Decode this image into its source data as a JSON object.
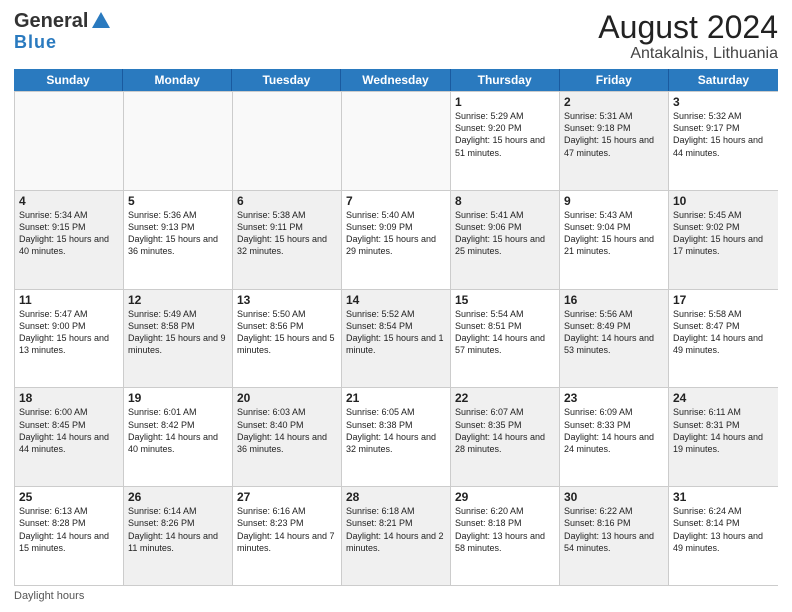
{
  "header": {
    "logo_general": "General",
    "logo_blue": "Blue",
    "month_year": "August 2024",
    "location": "Antakalnis, Lithuania"
  },
  "days_of_week": [
    "Sunday",
    "Monday",
    "Tuesday",
    "Wednesday",
    "Thursday",
    "Friday",
    "Saturday"
  ],
  "footer": {
    "daylight_hours": "Daylight hours"
  },
  "weeks": [
    {
      "cells": [
        {
          "day": "",
          "empty": true
        },
        {
          "day": "",
          "empty": true
        },
        {
          "day": "",
          "empty": true
        },
        {
          "day": "",
          "empty": true
        },
        {
          "day": "1",
          "sunrise": "Sunrise: 5:29 AM",
          "sunset": "Sunset: 9:20 PM",
          "daylight": "Daylight: 15 hours and 51 minutes.",
          "shaded": false
        },
        {
          "day": "2",
          "sunrise": "Sunrise: 5:31 AM",
          "sunset": "Sunset: 9:18 PM",
          "daylight": "Daylight: 15 hours and 47 minutes.",
          "shaded": true
        },
        {
          "day": "3",
          "sunrise": "Sunrise: 5:32 AM",
          "sunset": "Sunset: 9:17 PM",
          "daylight": "Daylight: 15 hours and 44 minutes.",
          "shaded": false
        }
      ]
    },
    {
      "cells": [
        {
          "day": "4",
          "sunrise": "Sunrise: 5:34 AM",
          "sunset": "Sunset: 9:15 PM",
          "daylight": "Daylight: 15 hours and 40 minutes.",
          "shaded": true
        },
        {
          "day": "5",
          "sunrise": "Sunrise: 5:36 AM",
          "sunset": "Sunset: 9:13 PM",
          "daylight": "Daylight: 15 hours and 36 minutes.",
          "shaded": false
        },
        {
          "day": "6",
          "sunrise": "Sunrise: 5:38 AM",
          "sunset": "Sunset: 9:11 PM",
          "daylight": "Daylight: 15 hours and 32 minutes.",
          "shaded": true
        },
        {
          "day": "7",
          "sunrise": "Sunrise: 5:40 AM",
          "sunset": "Sunset: 9:09 PM",
          "daylight": "Daylight: 15 hours and 29 minutes.",
          "shaded": false
        },
        {
          "day": "8",
          "sunrise": "Sunrise: 5:41 AM",
          "sunset": "Sunset: 9:06 PM",
          "daylight": "Daylight: 15 hours and 25 minutes.",
          "shaded": true
        },
        {
          "day": "9",
          "sunrise": "Sunrise: 5:43 AM",
          "sunset": "Sunset: 9:04 PM",
          "daylight": "Daylight: 15 hours and 21 minutes.",
          "shaded": false
        },
        {
          "day": "10",
          "sunrise": "Sunrise: 5:45 AM",
          "sunset": "Sunset: 9:02 PM",
          "daylight": "Daylight: 15 hours and 17 minutes.",
          "shaded": true
        }
      ]
    },
    {
      "cells": [
        {
          "day": "11",
          "sunrise": "Sunrise: 5:47 AM",
          "sunset": "Sunset: 9:00 PM",
          "daylight": "Daylight: 15 hours and 13 minutes.",
          "shaded": false
        },
        {
          "day": "12",
          "sunrise": "Sunrise: 5:49 AM",
          "sunset": "Sunset: 8:58 PM",
          "daylight": "Daylight: 15 hours and 9 minutes.",
          "shaded": true
        },
        {
          "day": "13",
          "sunrise": "Sunrise: 5:50 AM",
          "sunset": "Sunset: 8:56 PM",
          "daylight": "Daylight: 15 hours and 5 minutes.",
          "shaded": false
        },
        {
          "day": "14",
          "sunrise": "Sunrise: 5:52 AM",
          "sunset": "Sunset: 8:54 PM",
          "daylight": "Daylight: 15 hours and 1 minute.",
          "shaded": true
        },
        {
          "day": "15",
          "sunrise": "Sunrise: 5:54 AM",
          "sunset": "Sunset: 8:51 PM",
          "daylight": "Daylight: 14 hours and 57 minutes.",
          "shaded": false
        },
        {
          "day": "16",
          "sunrise": "Sunrise: 5:56 AM",
          "sunset": "Sunset: 8:49 PM",
          "daylight": "Daylight: 14 hours and 53 minutes.",
          "shaded": true
        },
        {
          "day": "17",
          "sunrise": "Sunrise: 5:58 AM",
          "sunset": "Sunset: 8:47 PM",
          "daylight": "Daylight: 14 hours and 49 minutes.",
          "shaded": false
        }
      ]
    },
    {
      "cells": [
        {
          "day": "18",
          "sunrise": "Sunrise: 6:00 AM",
          "sunset": "Sunset: 8:45 PM",
          "daylight": "Daylight: 14 hours and 44 minutes.",
          "shaded": true
        },
        {
          "day": "19",
          "sunrise": "Sunrise: 6:01 AM",
          "sunset": "Sunset: 8:42 PM",
          "daylight": "Daylight: 14 hours and 40 minutes.",
          "shaded": false
        },
        {
          "day": "20",
          "sunrise": "Sunrise: 6:03 AM",
          "sunset": "Sunset: 8:40 PM",
          "daylight": "Daylight: 14 hours and 36 minutes.",
          "shaded": true
        },
        {
          "day": "21",
          "sunrise": "Sunrise: 6:05 AM",
          "sunset": "Sunset: 8:38 PM",
          "daylight": "Daylight: 14 hours and 32 minutes.",
          "shaded": false
        },
        {
          "day": "22",
          "sunrise": "Sunrise: 6:07 AM",
          "sunset": "Sunset: 8:35 PM",
          "daylight": "Daylight: 14 hours and 28 minutes.",
          "shaded": true
        },
        {
          "day": "23",
          "sunrise": "Sunrise: 6:09 AM",
          "sunset": "Sunset: 8:33 PM",
          "daylight": "Daylight: 14 hours and 24 minutes.",
          "shaded": false
        },
        {
          "day": "24",
          "sunrise": "Sunrise: 6:11 AM",
          "sunset": "Sunset: 8:31 PM",
          "daylight": "Daylight: 14 hours and 19 minutes.",
          "shaded": true
        }
      ]
    },
    {
      "cells": [
        {
          "day": "25",
          "sunrise": "Sunrise: 6:13 AM",
          "sunset": "Sunset: 8:28 PM",
          "daylight": "Daylight: 14 hours and 15 minutes.",
          "shaded": false
        },
        {
          "day": "26",
          "sunrise": "Sunrise: 6:14 AM",
          "sunset": "Sunset: 8:26 PM",
          "daylight": "Daylight: 14 hours and 11 minutes.",
          "shaded": true
        },
        {
          "day": "27",
          "sunrise": "Sunrise: 6:16 AM",
          "sunset": "Sunset: 8:23 PM",
          "daylight": "Daylight: 14 hours and 7 minutes.",
          "shaded": false
        },
        {
          "day": "28",
          "sunrise": "Sunrise: 6:18 AM",
          "sunset": "Sunset: 8:21 PM",
          "daylight": "Daylight: 14 hours and 2 minutes.",
          "shaded": true
        },
        {
          "day": "29",
          "sunrise": "Sunrise: 6:20 AM",
          "sunset": "Sunset: 8:18 PM",
          "daylight": "Daylight: 13 hours and 58 minutes.",
          "shaded": false
        },
        {
          "day": "30",
          "sunrise": "Sunrise: 6:22 AM",
          "sunset": "Sunset: 8:16 PM",
          "daylight": "Daylight: 13 hours and 54 minutes.",
          "shaded": true
        },
        {
          "day": "31",
          "sunrise": "Sunrise: 6:24 AM",
          "sunset": "Sunset: 8:14 PM",
          "daylight": "Daylight: 13 hours and 49 minutes.",
          "shaded": false
        }
      ]
    }
  ]
}
